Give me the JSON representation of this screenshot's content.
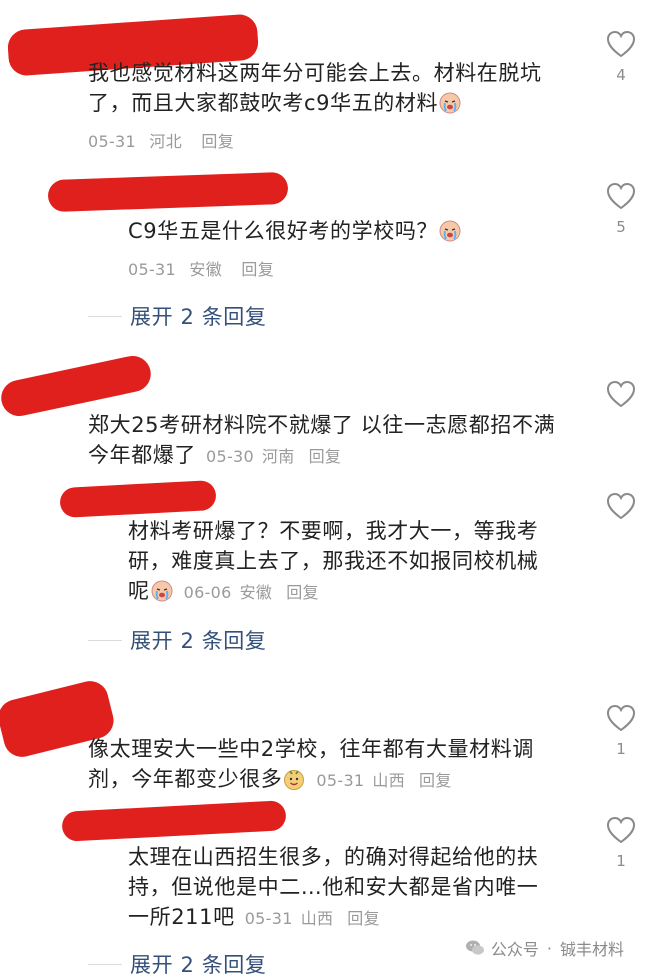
{
  "comments": [
    {
      "text_lines": [
        "我也感觉材料这两年分可能会上去。材料在脱坑",
        "了，而且大家都鼓吹考c9华五的材料"
      ],
      "date": "05-31",
      "location": "河北",
      "reply": "回复",
      "likes": "4"
    },
    {
      "text_lines": [
        "C9华五是什么很好考的学校吗？"
      ],
      "date": "05-31",
      "location": "安徽",
      "reply": "回复",
      "likes": "5"
    },
    {
      "text_lines": [
        "郑大25考研材料院不就爆了 以往一志愿都招不满",
        "今年都爆了"
      ],
      "date": "05-30",
      "location": "河南",
      "reply": "回复",
      "likes": ""
    },
    {
      "text_lines": [
        "材料考研爆了？不要啊，我才大一，等我考",
        "研，难度真上去了，那我还不如报同校机械",
        "呢"
      ],
      "date": "06-06",
      "location": "安徽",
      "reply": "回复",
      "likes": ""
    },
    {
      "text_lines": [
        "像太理安大一些中2学校，往年都有大量材料调",
        "剂，今年都变少很多"
      ],
      "date": "05-31",
      "location": "山西",
      "reply": "回复",
      "likes": "1"
    },
    {
      "text_lines": [
        "太理在山西招生很多，的确对得起给他的扶",
        "持，但说他是中二…他和安大都是省内唯一",
        "一所211吧"
      ],
      "date": "05-31",
      "location": "山西",
      "reply": "回复",
      "likes": "1"
    }
  ],
  "expand_replies": [
    "展开 2 条回复",
    "展开 2 条回复",
    "展开 2 条回复"
  ],
  "watermark": {
    "icon": "wechat-icon",
    "account_prefix": "公众号",
    "separator": "·",
    "name": "铖丰材料"
  },
  "colors": {
    "redaction": "#e0201d",
    "expand_link": "#34507a",
    "meta": "#9a9a9a"
  }
}
